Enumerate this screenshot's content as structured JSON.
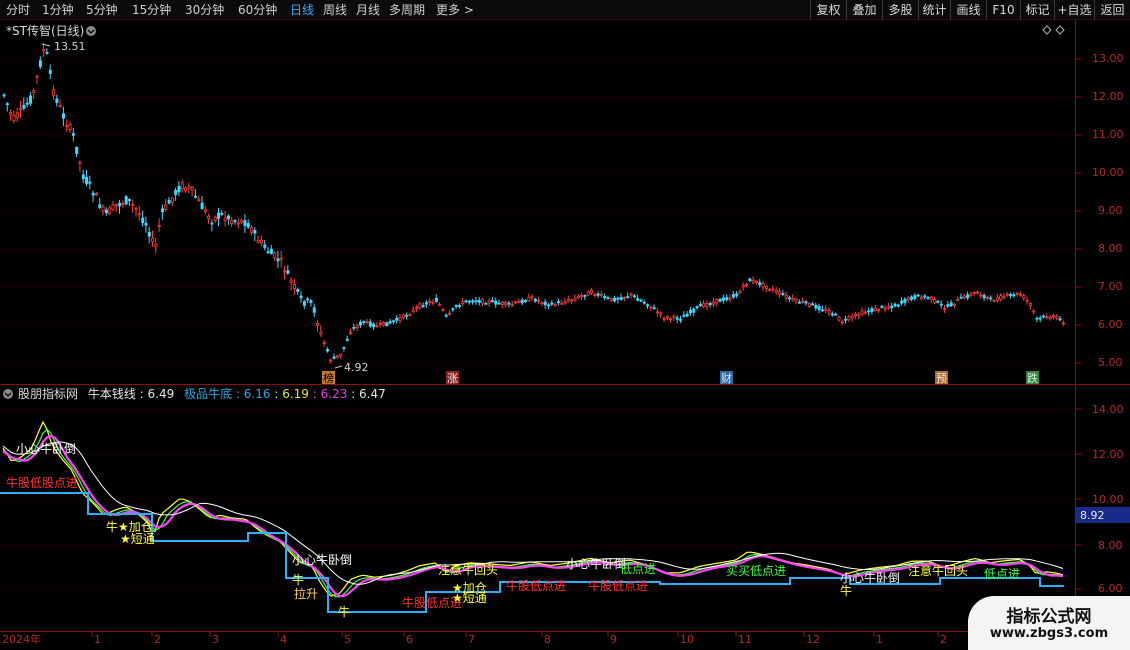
{
  "toolbar": {
    "timeframes": [
      "分时",
      "1分钟",
      "5分钟",
      "15分钟",
      "30分钟",
      "60分钟",
      "日线",
      "周线",
      "月线",
      "多周期",
      "更多"
    ],
    "active_timeframe": "日线",
    "more_arrow": ">",
    "right_buttons": [
      "复权",
      "叠加",
      "多股",
      "统计",
      "画线",
      "F10",
      "标记",
      "+自选",
      "返回"
    ]
  },
  "main_chart": {
    "title": "*ST传智(日线)",
    "diamond_icon": "diamond-icon",
    "high_label": "13.51",
    "low_label": "4.92",
    "y_ticks": [
      "13.00",
      "12.00",
      "11.00",
      "10.00",
      "9.00",
      "8.00",
      "7.00",
      "6.00",
      "5.00"
    ],
    "event_badges": [
      {
        "label": "榜",
        "color": "#c87a2a"
      },
      {
        "label": "涨",
        "color": "#8a2222"
      },
      {
        "label": "财",
        "color": "#2a6aa8"
      },
      {
        "label": "预",
        "color": "#b06a2a"
      },
      {
        "label": "跌",
        "color": "#2a8a3a"
      }
    ]
  },
  "indicator": {
    "name": "股朋指标网",
    "line1_name": "牛本钱线",
    "line1_value": "6.49",
    "line2_name": "极品牛底",
    "values": [
      "6.16",
      "6.19",
      "6.23",
      "6.47"
    ],
    "value_colors": [
      "#2aa8e0",
      "#e6e62a",
      "#e040e0",
      "#e6e6e6"
    ],
    "y_ticks": [
      "14.00",
      "12.00",
      "10.00",
      "8.00",
      "6.00"
    ],
    "current_price_tag": "8.92",
    "annotations": [
      {
        "text": "小心牛卧倒",
        "color": "#ffffff"
      },
      {
        "text": "牛股低股点进",
        "color": "#ff3030"
      },
      {
        "text": "★加仓",
        "color": "#ffff40"
      },
      {
        "text": "★短通",
        "color": "#ffff40"
      },
      {
        "text": "牛",
        "color": "#ffff40"
      },
      {
        "text": "小心牛卧倒",
        "color": "#ffffff"
      },
      {
        "text": "牛",
        "color": "#ffff40"
      },
      {
        "text": "拉升",
        "color": "#ffd040"
      },
      {
        "text": "牛",
        "color": "#ffff40"
      },
      {
        "text": "注意牛回头",
        "color": "#ffff40"
      },
      {
        "text": "牛股低点进",
        "color": "#ff3030"
      },
      {
        "text": "★加仓",
        "color": "#ffff40"
      },
      {
        "text": "★短通",
        "color": "#ffff40"
      },
      {
        "text": "牛股低点进",
        "color": "#ff3030"
      },
      {
        "text": "小心牛卧倒",
        "color": "#ffffff"
      },
      {
        "text": "低点进",
        "color": "#40ff40"
      },
      {
        "text": "牛股低点进",
        "color": "#ff3030"
      },
      {
        "text": "买买低点进",
        "color": "#40ff40"
      },
      {
        "text": "小心牛卧倒",
        "color": "#ffffff"
      },
      {
        "text": "牛",
        "color": "#ffff40"
      },
      {
        "text": "注意牛回头",
        "color": "#ffff40"
      },
      {
        "text": "低点进",
        "color": "#40ff40"
      }
    ]
  },
  "x_axis": {
    "labels": [
      "2024年",
      "1",
      "2",
      "3",
      "4",
      "5",
      "6",
      "7",
      "8",
      "9",
      "10",
      "11",
      "12",
      "1",
      "2"
    ]
  },
  "watermark": {
    "line1": "指标公式网",
    "line2": "www.zbgs3.com"
  }
}
